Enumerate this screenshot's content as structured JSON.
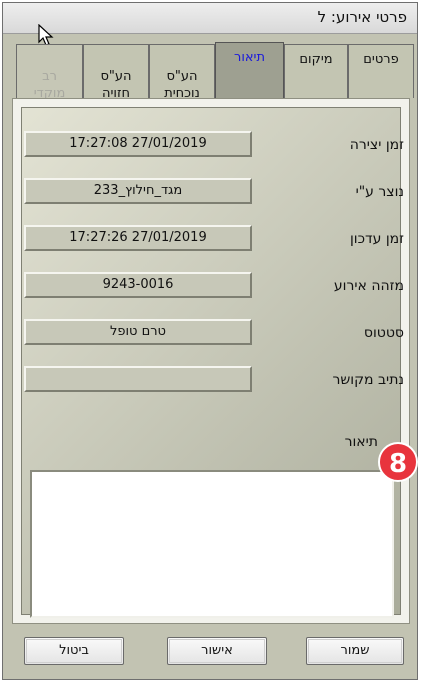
{
  "window": {
    "title": "פרטי אירוע: ל"
  },
  "tabs": [
    {
      "label": "פרטים"
    },
    {
      "label": "מיקום"
    },
    {
      "label": "תיאור"
    },
    {
      "label": "הע\"ס\nנוכחית"
    },
    {
      "label": "הע\"ס\nחזויה"
    },
    {
      "label": "רב\nמוקדי"
    }
  ],
  "fields": {
    "created_time": {
      "label": "זמן יצירה",
      "value": "27/01/2019 17:27:08"
    },
    "created_by": {
      "label": "נוצר ע\"י",
      "value": "מגד_חילוץ_233"
    },
    "updated_time": {
      "label": "זמן עדכון",
      "value": "27/01/2019 17:27:26"
    },
    "event_id": {
      "label": "מזהה אירוע",
      "value": "9243-0016"
    },
    "status": {
      "label": "סטטוס",
      "value": "טרם טופל"
    },
    "linked_path": {
      "label": "נתיב מקושר",
      "value": ""
    }
  },
  "description": {
    "label": "תיאור",
    "value": ""
  },
  "badge": {
    "text": "8"
  },
  "buttons": {
    "save": "שמור",
    "confirm": "אישור",
    "cancel": "ביטול"
  },
  "colors": {
    "active_tab_text": "#1a1adc",
    "badge": "#e8343d",
    "panel_bg": "#c2c3b2"
  }
}
